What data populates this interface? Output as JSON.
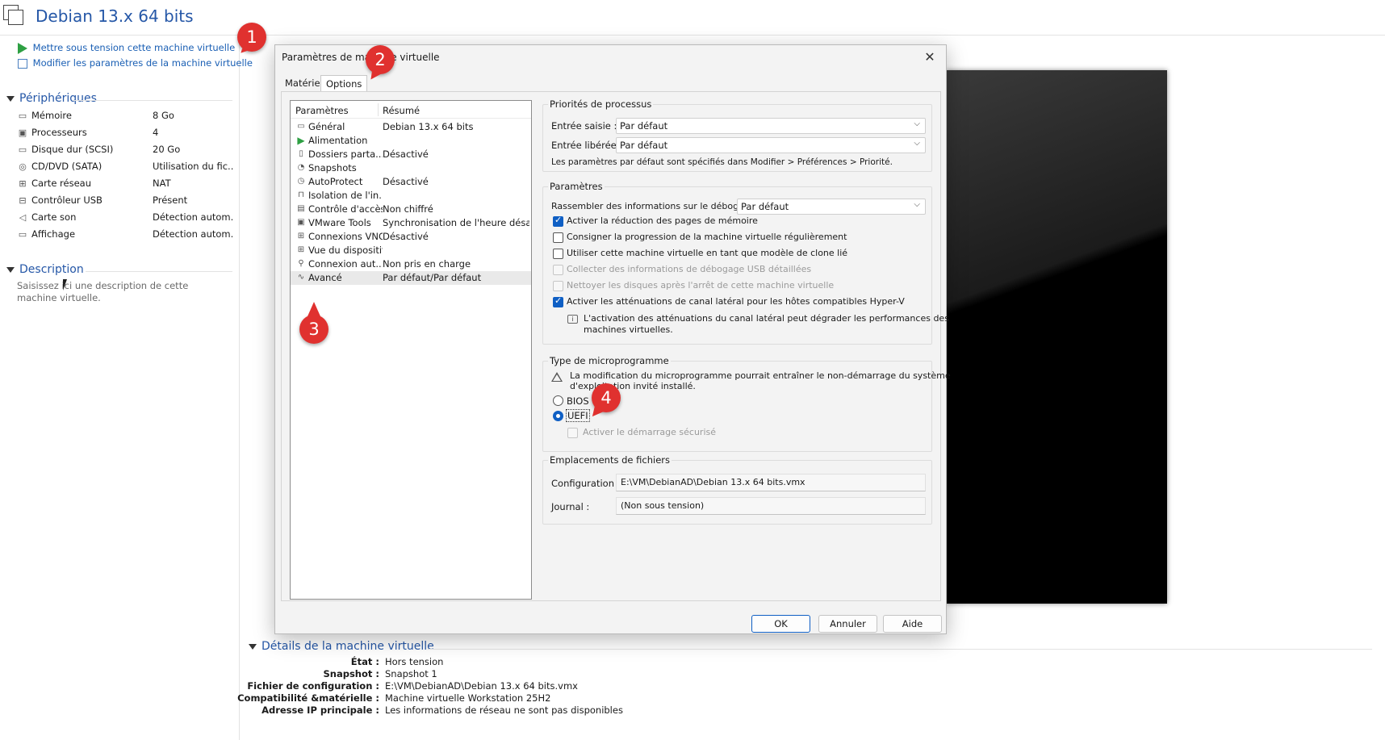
{
  "vm": {
    "title": "Debian 13.x 64 bits"
  },
  "actions": {
    "power_on": "Mettre sous tension cette machine virtuelle",
    "edit_settings": "Modifier les paramètres de la machine virtuelle"
  },
  "devices": {
    "header": "Périphériques",
    "items": [
      {
        "icon": "memory-icon",
        "name": "Mémoire",
        "value": "8 Go"
      },
      {
        "icon": "cpu-icon",
        "name": "Processeurs",
        "value": "4"
      },
      {
        "icon": "hard-disk-icon",
        "name": "Disque dur (SCSI)",
        "value": "20 Go"
      },
      {
        "icon": "cd-dvd-icon",
        "name": "CD/DVD (SATA)",
        "value": "Utilisation du fic..."
      },
      {
        "icon": "network-icon",
        "name": "Carte réseau",
        "value": "NAT"
      },
      {
        "icon": "usb-icon",
        "name": "Contrôleur USB",
        "value": "Présent"
      },
      {
        "icon": "speaker-icon",
        "name": "Carte son",
        "value": "Détection autom..."
      },
      {
        "icon": "monitor-icon",
        "name": "Affichage",
        "value": "Détection autom..."
      }
    ]
  },
  "description": {
    "header": "Description",
    "placeholder": "Saisissez ici une description de cette machine virtuelle."
  },
  "details": {
    "header": "Détails de la machine virtuelle",
    "rows": [
      {
        "label": "État :",
        "value": "Hors tension"
      },
      {
        "label": "Snapshot :",
        "value": "Snapshot 1"
      },
      {
        "label": "Fichier de configuration :",
        "value": "E:\\VM\\DebianAD\\Debian 13.x 64 bits.vmx"
      },
      {
        "label": "Compatibilité &matérielle :",
        "value": "Machine virtuelle Workstation 25H2"
      },
      {
        "label": "Adresse IP principale :",
        "value": "Les informations de réseau ne sont pas disponibles"
      }
    ]
  },
  "dialog": {
    "title": "Paramètres de machine virtuelle",
    "tabs": [
      "Matériel",
      "Options"
    ],
    "list": {
      "col_settings": "Paramètres",
      "col_summary": "Résumé",
      "rows": [
        {
          "icon": "general-icon",
          "name": "Général",
          "summary": "Debian 13.x 64 bits"
        },
        {
          "icon": "power-icon",
          "name": "Alimentation",
          "summary": ""
        },
        {
          "icon": "shared-folders-icon",
          "name": "Dossiers parta...",
          "summary": "Désactivé"
        },
        {
          "icon": "snapshots-icon",
          "name": "Snapshots",
          "summary": ""
        },
        {
          "icon": "autoprotect-icon",
          "name": "AutoProtect",
          "summary": "Désactivé"
        },
        {
          "icon": "isolation-icon",
          "name": "Isolation de l'in...",
          "summary": ""
        },
        {
          "icon": "access-control-icon",
          "name": "Contrôle d'accès",
          "summary": "Non chiffré"
        },
        {
          "icon": "vmware-tools-icon",
          "name": "VMware Tools",
          "summary": "Synchronisation de l'heure désacti..."
        },
        {
          "icon": "vnc-icon",
          "name": "Connexions VNC",
          "summary": "Désactivé"
        },
        {
          "icon": "device-view-icon",
          "name": "Vue du dispositif",
          "summary": ""
        },
        {
          "icon": "auto-connect-icon",
          "name": "Connexion aut...",
          "summary": "Non pris en charge"
        },
        {
          "icon": "advanced-icon",
          "name": "Avancé",
          "summary": "Par défaut/Par défaut"
        }
      ]
    },
    "process_priorities": {
      "title": "Priorités de processus",
      "input_grabbed_label": "Entrée saisie :",
      "input_grabbed_value": "Par défaut",
      "input_ungrabbed_label": "Entrée libérée :",
      "input_ungrabbed_value": "Par défaut",
      "note": "Les paramètres par défaut sont spécifiés dans Modifier > Préférences > Priorité."
    },
    "settings": {
      "title": "Paramètres",
      "debug_label": "Rassembler des informations sur le débogage :",
      "debug_value": "Par défaut",
      "checks": [
        {
          "label": "Activer la réduction des pages de mémoire",
          "checked": true,
          "disabled": false
        },
        {
          "label": "Consigner la progression de la machine virtuelle régulièrement",
          "checked": false,
          "disabled": false
        },
        {
          "label": "Utiliser cette machine virtuelle en tant que modèle de clone lié",
          "checked": false,
          "disabled": false
        },
        {
          "label": "Collecter des informations de débogage USB détaillées",
          "checked": false,
          "disabled": true
        },
        {
          "label": "Nettoyer les disques après l'arrêt de cette machine virtuelle",
          "checked": false,
          "disabled": true
        },
        {
          "label": "Activer les atténuations de canal latéral pour les hôtes compatibles Hyper-V",
          "checked": true,
          "disabled": false
        }
      ],
      "info_line1": "L'activation des atténuations du canal latéral peut dégrader les performances des",
      "info_line2": "machines virtuelles."
    },
    "firmware": {
      "title": "Type de microprogramme",
      "warning_line1": "La modification du microprogramme pourrait entraîner le non-démarrage du système",
      "warning_line2": "d'exploitation invité installé.",
      "bios": "BIOS",
      "uefi": "UEFI",
      "selected": "UEFI",
      "secure_boot": "Activer le démarrage sécurisé"
    },
    "file_locations": {
      "title": "Emplacements de fichiers",
      "config_label": "Configuration :",
      "config_value": "E:\\VM\\DebianAD\\Debian 13.x 64 bits.vmx",
      "log_label": "Journal :",
      "log_value": "(Non sous tension)"
    },
    "buttons": {
      "ok": "OK",
      "cancel": "Annuler",
      "help": "Aide"
    }
  },
  "badges": [
    "1",
    "2",
    "3",
    "4"
  ],
  "colors": {
    "accent": "#0f5fc4",
    "link": "#1a5fb4",
    "badge": "#e0312f",
    "header_blue": "#2557a7"
  }
}
